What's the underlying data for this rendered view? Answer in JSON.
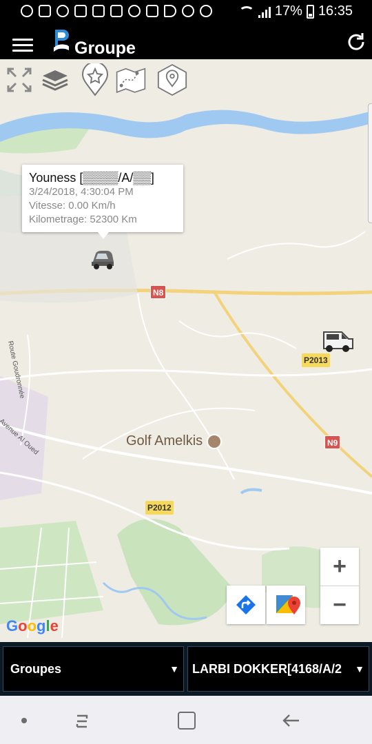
{
  "status_bar": {
    "battery": "17%",
    "time": "16:35",
    "battery_level": 0.17
  },
  "header": {
    "title": "Groupe",
    "icons": [
      "menu-icon",
      "app-logo",
      "refresh-icon"
    ]
  },
  "map_tools": [
    "expand-icon",
    "layers-icon",
    "favorite-pin-icon",
    "route-map-icon",
    "poi-pin-icon"
  ],
  "popup": {
    "title": "Youness [▒▒▒▒/A/▒▒]",
    "datetime": "3/24/2018, 4:30:04 PM",
    "speed": "Vitesse: 0.00 Km/h",
    "mileage": "Kilometrage: 52300 Km"
  },
  "map_labels": {
    "road_n8": "N8",
    "road_n9": "N9",
    "road_p2013": "P2013",
    "road_p2012": "P2012",
    "place": "Golf Amelkis",
    "street_1": "Route Goudronnée",
    "street_2": "Avenue Al Oued",
    "google": [
      "G",
      "o",
      "o",
      "g",
      "l",
      "e"
    ]
  },
  "map_controls": {
    "zoom_in": "+",
    "zoom_out": "−"
  },
  "selectors": {
    "group": "Groupes",
    "vehicle": "LARBI DOKKER[4168/A/2",
    "caret": "▼"
  },
  "colors": {
    "header_bg": "#000000",
    "map_bg": "#efece3",
    "water": "#9fc9f0",
    "highway": "#f2d27a",
    "shield_red": "#d9534f",
    "shield_yellow": "#f6d85b",
    "selector_bg": "#0c1a26"
  }
}
